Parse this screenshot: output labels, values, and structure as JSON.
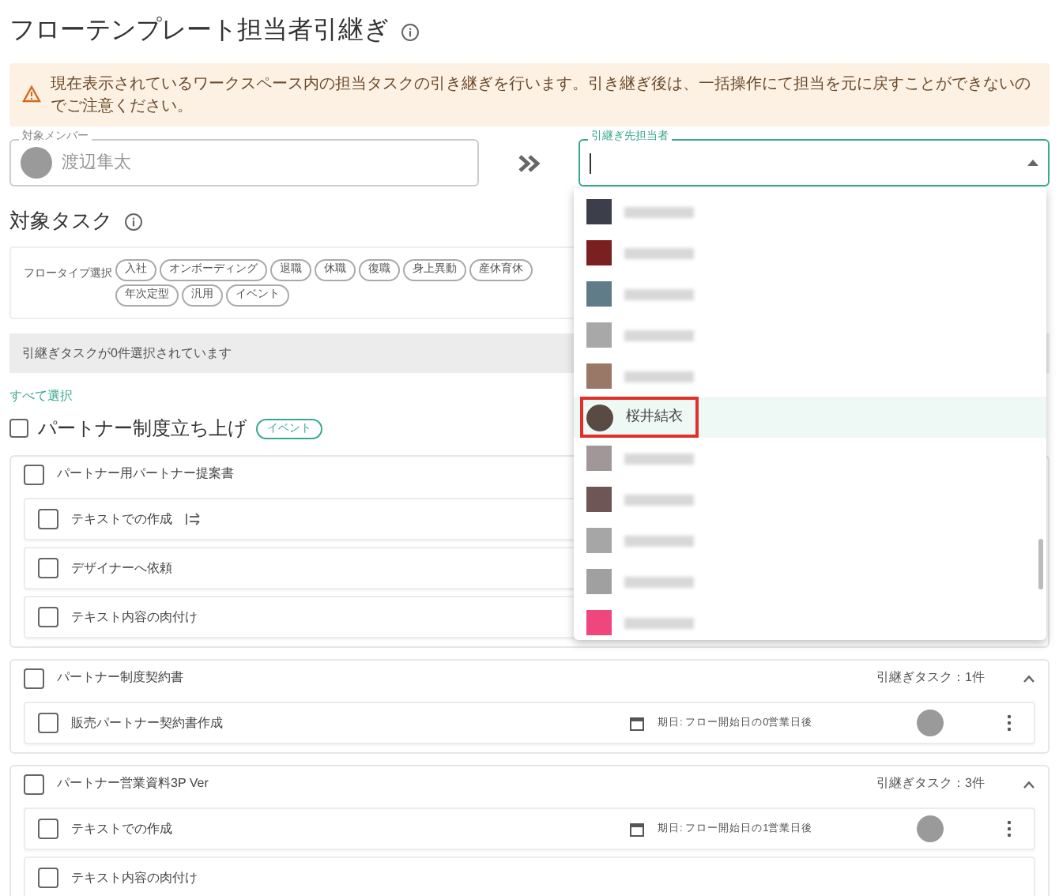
{
  "page_title": "フローテンプレート担当者引継ぎ",
  "alert": "現在表示されているワークスペース内の担当タスクの引き継ぎを行います。引き継ぎ後は、一括操作にて担当を元に戻すことができないのでご注意ください。",
  "source_field": {
    "label": "対象メンバー",
    "value": "渡辺隼太"
  },
  "target_field": {
    "label": "引継ぎ先担当者",
    "expanded": true
  },
  "dropdown": [
    {
      "kind": "blurred",
      "color": "#3c3f4a"
    },
    {
      "kind": "blurred",
      "color": "#7a2020"
    },
    {
      "kind": "blurred",
      "color": "#5f7c88"
    },
    {
      "kind": "blurred",
      "color": "#a8a8a8"
    },
    {
      "kind": "blurred",
      "color": "#9a7868"
    },
    {
      "kind": "person",
      "name": "桜井結衣",
      "selected": true
    },
    {
      "kind": "blurred",
      "color": "#a09898"
    },
    {
      "kind": "blurred",
      "color": "#6e5656"
    },
    {
      "kind": "blurred",
      "color": "#a6a6a6"
    },
    {
      "kind": "blurred",
      "color": "#a0a0a0"
    },
    {
      "kind": "blurred",
      "color": "#f0467e"
    }
  ],
  "section_title": "対象タスク",
  "filter_label": "フロータイプ選択",
  "flow_types": [
    "入社",
    "オンボーディング",
    "退職",
    "休職",
    "復職",
    "身上異動",
    "産休育休",
    "年次定型",
    "汎用",
    "イベント"
  ],
  "selection_status": "引継ぎタスクが0件選択されています",
  "select_all": "すべて選択",
  "flows": [
    {
      "title": "パートナー制度立ち上げ",
      "tag": "イベント",
      "checked": false,
      "task_groups": [
        {
          "title": "パートナー用パートナー提案書",
          "checked": false,
          "tasks": [
            {
              "title": "テキストでの作成",
              "checked": false,
              "linked": true
            },
            {
              "title": "デザイナーへ依頼",
              "checked": false,
              "linked": false
            },
            {
              "title": "テキスト内容の肉付け",
              "checked": false,
              "linked": false
            }
          ]
        },
        {
          "title": "パートナー制度契約書",
          "checked": false,
          "count": "引継ぎタスク：1件",
          "expanded": true,
          "tasks": [
            {
              "title": "販売パートナー契約書作成",
              "checked": false,
              "linked": false,
              "due": "期日: フロー開始日の0営業日後"
            }
          ]
        },
        {
          "title": "パートナー営業資料3P Ver",
          "checked": false,
          "count": "引継ぎタスク：3件",
          "expanded": true,
          "tasks": [
            {
              "title": "テキストでの作成",
              "checked": false,
              "linked": false,
              "due": "期日: フロー開始日の1営業日後"
            },
            {
              "title": "テキスト内容の肉付け",
              "checked": false,
              "linked": false
            }
          ]
        }
      ]
    }
  ]
}
